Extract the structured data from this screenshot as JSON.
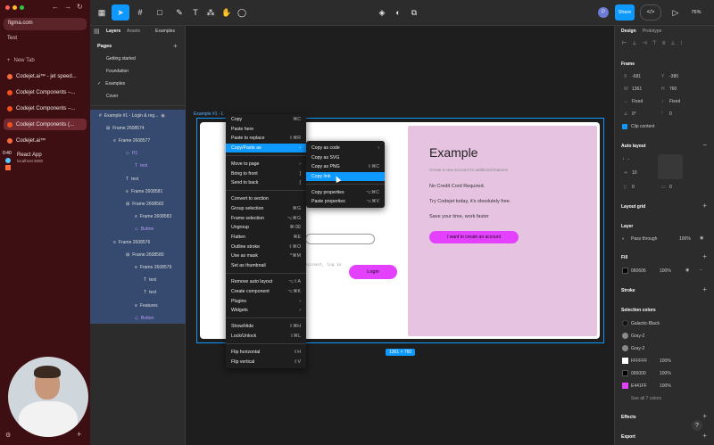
{
  "browser": {
    "url": "figma.com",
    "profile": "Test",
    "new_tab": "New Tab",
    "tabs": [
      {
        "label": "Codejet.ai™ - jet speed..."
      },
      {
        "label": "Codejet Components –..."
      },
      {
        "label": "Codejet Components –..."
      },
      {
        "label": "Codejet Components (..."
      },
      {
        "label": "Codejet.ai™"
      }
    ],
    "react_app": "React App",
    "react_url": "localhost:3000",
    "time": "0:40"
  },
  "panel": {
    "tab_layers": "Layers",
    "tab_assets": "Assets",
    "examples": "Examples",
    "pages_title": "Pages"
  },
  "pages": [
    "Getting started",
    "Foundation",
    "Examples",
    "Cover"
  ],
  "layers": [
    {
      "label": "Example #1 - Login & reg..."
    },
    {
      "label": "Frame 2608574"
    },
    {
      "label": "Frame 2608577"
    },
    {
      "label": "H1"
    },
    {
      "label": "text"
    },
    {
      "label": "text"
    },
    {
      "label": "Frame 2608581"
    },
    {
      "label": "Frame 2608582"
    },
    {
      "label": "Frame 2608583"
    },
    {
      "label": "Button"
    },
    {
      "label": "Frame 2608576"
    },
    {
      "label": "Frame 2608580"
    },
    {
      "label": "Frame 2608579"
    },
    {
      "label": "text"
    },
    {
      "label": "text"
    },
    {
      "label": "Features"
    },
    {
      "label": "Button"
    }
  ],
  "topbar": {
    "share": "Share",
    "zoom": "76%",
    "avatar": "P"
  },
  "canvas": {
    "frame_label": "Example #1 - L",
    "size_badge": "1361 × 760",
    "heading": "Example",
    "subtitle": "Create a new account for additional features",
    "line1": "No Credit Cord Required.",
    "line2": "Try Codejet today, it's obsolutely free.",
    "line3": "Save your time, work faster",
    "cta": "I want to create an account",
    "login": "Login",
    "partial": "account, log in"
  },
  "context_menu": {
    "items": [
      {
        "label": "Copy",
        "sc": "⌘C"
      },
      {
        "label": "Paste here",
        "sc": ""
      },
      {
        "label": "Paste to replace",
        "sc": "⇧⌘R"
      },
      {
        "label": "Copy/Paste as",
        "sc": "›"
      },
      {
        "label": "Move to page",
        "sc": "›"
      },
      {
        "label": "Bring to front",
        "sc": "]"
      },
      {
        "label": "Send to back",
        "sc": "["
      },
      {
        "label": "Convert to section",
        "sc": ""
      },
      {
        "label": "Group selection",
        "sc": "⌘G"
      },
      {
        "label": "Frame selection",
        "sc": "⌥⌘G"
      },
      {
        "label": "Ungroup",
        "sc": "⌘⌫"
      },
      {
        "label": "Flatten",
        "sc": "⌘E"
      },
      {
        "label": "Outline stroke",
        "sc": "⇧⌘O"
      },
      {
        "label": "Use as mask",
        "sc": "^⌘M"
      },
      {
        "label": "Set as thumbnail",
        "sc": ""
      },
      {
        "label": "Remove auto layout",
        "sc": "⌥⇧A"
      },
      {
        "label": "Create component",
        "sc": "⌥⌘K"
      },
      {
        "label": "Plugins",
        "sc": "›"
      },
      {
        "label": "Widgets",
        "sc": "›"
      },
      {
        "label": "Show/Hide",
        "sc": "⇧⌘H"
      },
      {
        "label": "Lock/Unlock",
        "sc": "⇧⌘L"
      },
      {
        "label": "Flip horizontal",
        "sc": "⇧H"
      },
      {
        "label": "Flip vertical",
        "sc": "⇧V"
      }
    ]
  },
  "submenu": {
    "items": [
      {
        "label": "Copy as code",
        "sc": "›"
      },
      {
        "label": "Copy as SVG",
        "sc": ""
      },
      {
        "label": "Copy as PNG",
        "sc": "⇧⌘C"
      },
      {
        "label": "Copy link",
        "sc": ""
      },
      {
        "label": "Copy properties",
        "sc": "⌥⌘C"
      },
      {
        "label": "Paste properties",
        "sc": "⌥⌘V"
      }
    ]
  },
  "right": {
    "tab_design": "Design",
    "tab_prototype": "Prototype",
    "frame": "Frame",
    "x": "-681",
    "y": "-380",
    "w": "1361",
    "h": "760",
    "fixed_w": "Fixed",
    "fixed_h": "Fixed",
    "rotation": "0°",
    "radius": "0",
    "clip": "Clip content",
    "auto_layout": "Auto layout",
    "gap": "10",
    "pad_h": "0",
    "pad_v": "0",
    "layout_grid": "Layout grid",
    "layer": "Layer",
    "blend": "Pass through",
    "opacity": "100%",
    "fill": "Fill",
    "fill_hex": "060606",
    "fill_op": "100%",
    "stroke": "Stroke",
    "sel_colors": "Selection colors",
    "colors": [
      {
        "name": "Galactic-Black",
        "hex": "#111111"
      },
      {
        "name": "Gray-2",
        "hex": "#8a8a8a"
      },
      {
        "name": "Gray-2",
        "hex": "#8a8a8a"
      },
      {
        "name": "FFFFFF",
        "hex": "#ffffff",
        "op": "100%"
      },
      {
        "name": "000000",
        "hex": "#000000",
        "op": "100%"
      },
      {
        "name": "E441FF",
        "hex": "#e441ff",
        "op": "100%"
      }
    ],
    "see_all": "See all 7 colors",
    "effects": "Effects",
    "export": "Export"
  },
  "colors": {
    "accent": "#0d99ff",
    "magenta": "#e441ff",
    "pink_panel": "#e6c3e1",
    "sidebar": "#3e0f12"
  }
}
